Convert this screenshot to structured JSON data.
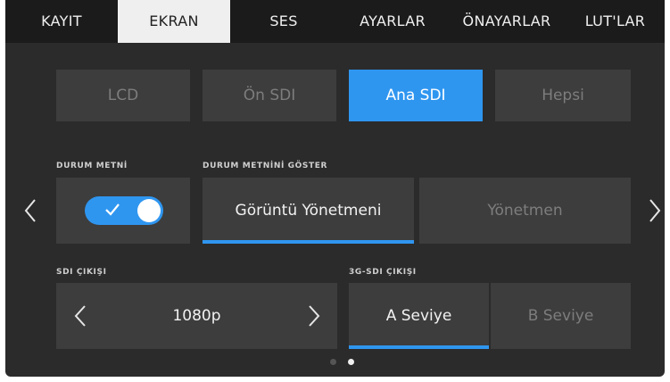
{
  "tabs": [
    {
      "label": "KAYIT",
      "active": false
    },
    {
      "label": "EKRAN",
      "active": true
    },
    {
      "label": "SES",
      "active": false
    },
    {
      "label": "AYARLAR",
      "active": false
    },
    {
      "label": "ÖNAYARLAR",
      "active": false
    },
    {
      "label": "LUT'LAR",
      "active": false
    }
  ],
  "outputs": {
    "lcd": "LCD",
    "front_sdi": "Ön SDI",
    "main_sdi": "Ana SDI",
    "all": "Hepsi",
    "selected": "Ana SDI"
  },
  "status_text": {
    "label": "DURUM METNİ",
    "enabled": true
  },
  "show_status_text": {
    "label": "DURUM METNİNİ GÖSTER",
    "options": [
      "Görüntü Yönetmeni",
      "Yönetmen"
    ],
    "selected": "Görüntü Yönetmeni"
  },
  "sdi_output": {
    "label": "SDI ÇIKIŞI",
    "value": "1080p"
  },
  "sdi_3g_output": {
    "label": "3G-SDI ÇIKIŞI",
    "options": [
      "A Seviye",
      "B Seviye"
    ],
    "selected": "A Seviye"
  },
  "pagination": {
    "total": 2,
    "current": 2
  },
  "colors": {
    "accent": "#2f96f0",
    "background": "#2b2b2b",
    "tile": "#3d3d3d",
    "tabbar": "#1b1b1b",
    "active_tab": "#efefef"
  },
  "icons": {
    "page_prev": "chevron-left-icon",
    "page_next": "chevron-right-icon",
    "toggle_check": "checkmark-icon",
    "value_dec": "chevron-left-icon",
    "value_inc": "chevron-right-icon"
  }
}
